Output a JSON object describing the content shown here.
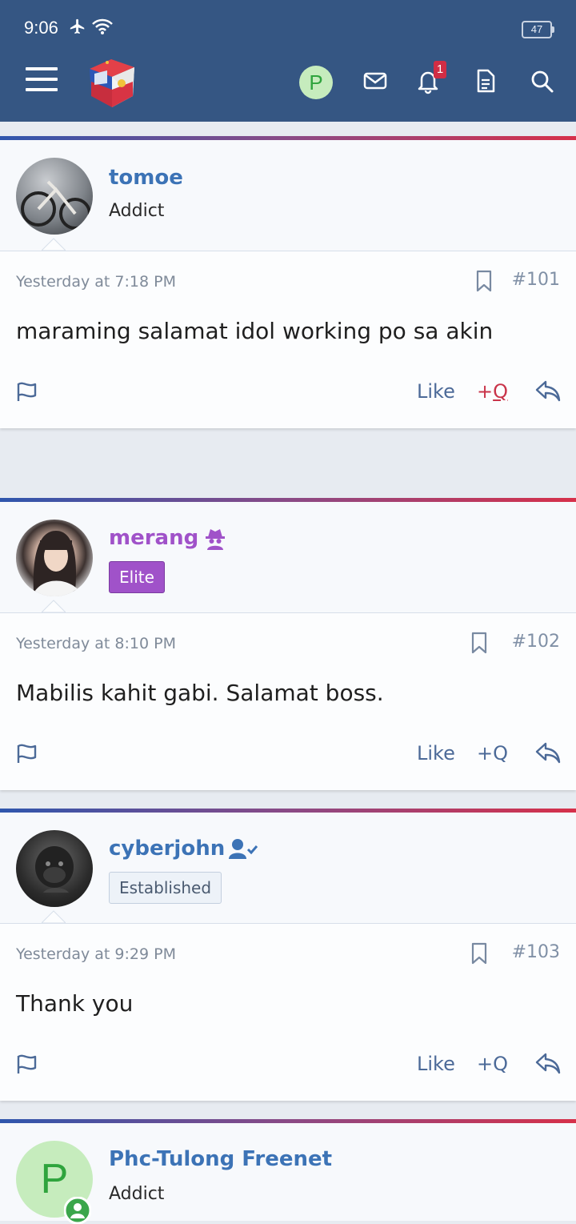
{
  "status": {
    "time": "9:06",
    "battery": "47"
  },
  "nav": {
    "avatar_letter": "P",
    "notifications_count": "1"
  },
  "colors": {
    "navbar": "#355683",
    "link": "#3c73b6",
    "elite": "#a052c9",
    "reaction_active": "#c9344a"
  },
  "posts": [
    {
      "username": "tomoe",
      "user_title": "Addict",
      "time": "Yesterday at 7:18 PM",
      "number": "#101",
      "content": "maraming salamat idol working po sa akin",
      "like": "Like",
      "quote_plus": "+",
      "quote_q": "Q"
    },
    {
      "username": "merang",
      "user_title": "Elite",
      "time": "Yesterday at 8:10 PM",
      "number": "#102",
      "content": "Mabilis kahit gabi. Salamat boss.",
      "like": "Like",
      "quote_plus": "+",
      "quote_q": "Q"
    },
    {
      "username": "cyberjohn",
      "user_title": "Established",
      "time": "Yesterday at 9:29 PM",
      "number": "#103",
      "content": "Thank you",
      "like": "Like",
      "quote_plus": "+",
      "quote_q": "Q"
    },
    {
      "username": "Phc-Tulong Freenet",
      "user_title": "Addict",
      "avatar_letter": "P"
    }
  ],
  "icons": [
    "hamburger-icon",
    "logo",
    "mail-icon",
    "bell-icon",
    "document-icon",
    "search-icon",
    "bookmark-icon",
    "flag-icon",
    "reply-icon",
    "spy-icon",
    "user-check-icon",
    "online-icon"
  ]
}
